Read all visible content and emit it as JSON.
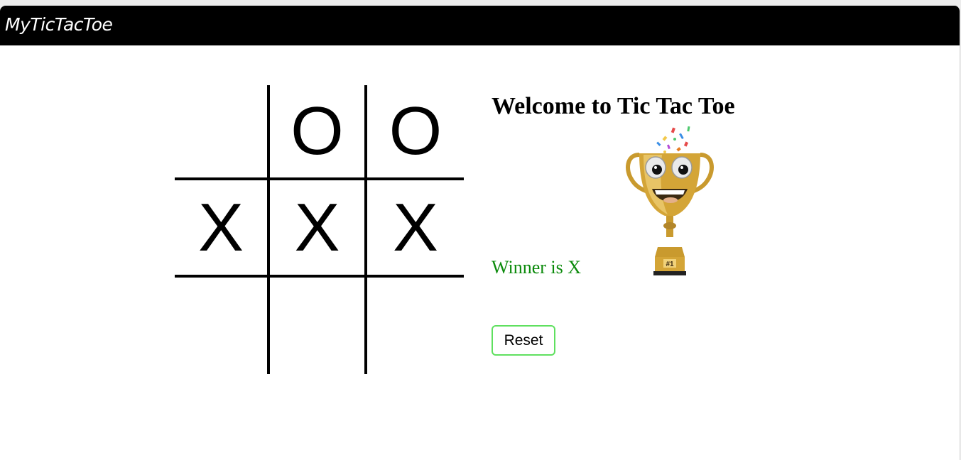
{
  "navbar": {
    "brand": "MyTicTacToe"
  },
  "board": {
    "cells": [
      "",
      "O",
      "O",
      "X",
      "X",
      "X",
      "",
      "",
      ""
    ]
  },
  "sidebar": {
    "title": "Welcome to Tic Tac Toe",
    "winner_text": "Winner is X",
    "reset_label": "Reset",
    "trophy_label": "#1"
  },
  "colors": {
    "navbar_bg": "#000000",
    "winner_text": "#0a8a0a",
    "reset_border": "#5fe05f"
  }
}
